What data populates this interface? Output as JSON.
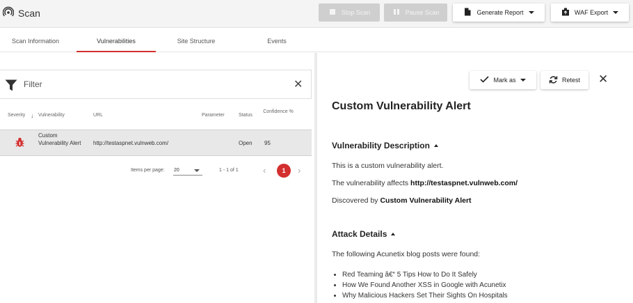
{
  "app": {
    "title": "Scan"
  },
  "toolbar": {
    "stop_label": "Stop Scan",
    "pause_label": "Pause Scan",
    "report_label": "Generate Report",
    "waf_label": "WAF Export"
  },
  "tabs": [
    {
      "label": "Scan Information",
      "active": false
    },
    {
      "label": "Vulnerabilities",
      "active": true
    },
    {
      "label": "Site Structure",
      "active": false
    },
    {
      "label": "Events",
      "active": false
    }
  ],
  "filter": {
    "label": "Filter"
  },
  "table": {
    "headers": {
      "severity": "Severity",
      "vulnerability": "Vulnerability",
      "url": "URL",
      "parameter": "Parameter",
      "status": "Status",
      "confidence": "Confidence %"
    },
    "rows": [
      {
        "vulnerability": "Custom Vulnerability Alert",
        "url": "http://testaspnet.vulnweb.com/",
        "parameter": "",
        "status": "Open",
        "confidence": "95"
      }
    ]
  },
  "pager": {
    "items_label": "Items per page:",
    "items_value": "20",
    "range": "1 - 1 of 1",
    "current_page": "1"
  },
  "detail": {
    "mark_as_label": "Mark as",
    "retest_label": "Retest",
    "title": "Custom Vulnerability Alert",
    "description_heading": "Vulnerability Description",
    "description_text": "This is a custom vulnerability alert.",
    "affects_prefix": "The vulnerability affects ",
    "affects_url": "http://testaspnet.vulnweb.com/",
    "discovered_prefix": "Discovered by ",
    "discovered_by": "Custom Vulnerability Alert",
    "attack_heading": "Attack Details",
    "attack_intro": "The following Acunetix blog posts were found:",
    "blog_posts": [
      "Red Teaming â€“ 5 Tips How to Do It Safely",
      "How We Found Another XSS in Google with Acunetix",
      "Why Malicious Hackers Set Their Sights On Hospitals"
    ]
  },
  "colors": {
    "accent": "#d32f2f",
    "disabled": "#cfcfcf",
    "topbar": "#f4f4f4"
  }
}
